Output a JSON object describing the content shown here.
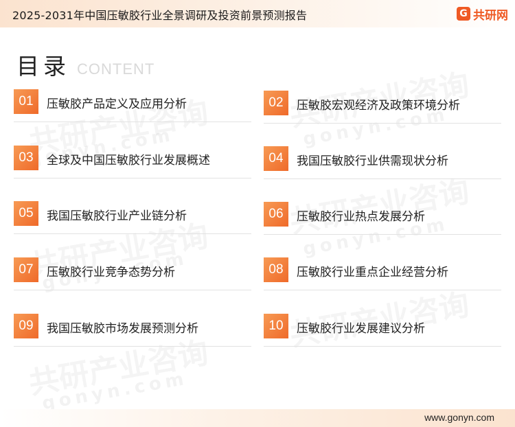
{
  "header": {
    "title": "2025-2031年中国压敏胶行业全景调研及投资前景预测报告",
    "brand_mark": "G",
    "brand_name": "共研网"
  },
  "heading": {
    "main": "目录",
    "sub": "CONTENT"
  },
  "watermark": {
    "text": "共研产业咨询",
    "sub": "gonyn.com"
  },
  "toc": [
    {
      "num": "01",
      "label": "压敏胶产品定义及应用分析"
    },
    {
      "num": "02",
      "label": "压敏胶宏观经济及政策环境分析"
    },
    {
      "num": "03",
      "label": "全球及中国压敏胶行业发展概述"
    },
    {
      "num": "04",
      "label": "我国压敏胶行业供需现状分析"
    },
    {
      "num": "05",
      "label": "我国压敏胶行业产业链分析"
    },
    {
      "num": "06",
      "label": "压敏胶行业热点发展分析"
    },
    {
      "num": "07",
      "label": "压敏胶行业竞争态势分析"
    },
    {
      "num": "08",
      "label": "压敏胶行业重点企业经营分析"
    },
    {
      "num": "09",
      "label": "我国压敏胶市场发展预测分析"
    },
    {
      "num": "10",
      "label": "压敏胶行业发展建议分析"
    }
  ],
  "footer": {
    "url": "www.gonyn.com"
  },
  "colors": {
    "accent": "#ef6a2a",
    "accent_light": "#f79a54",
    "brand": "#ef5a24"
  }
}
